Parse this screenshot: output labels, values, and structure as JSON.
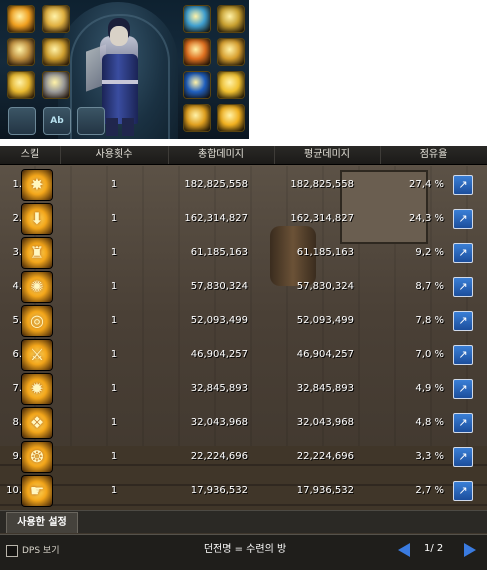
{
  "equipment": {
    "left_slots": [
      {
        "level": "",
        "stars": "",
        "icon": "fire-burst-icon",
        "color": "#f0a020"
      },
      {
        "level": "",
        "stars": "",
        "icon": "winged-orb-icon",
        "color": "#e0b040"
      },
      {
        "level": "",
        "stars": "",
        "icon": "gem-cluster-icon",
        "color": "#c09040"
      },
      {
        "level": "",
        "stars": "",
        "icon": "dark-sigil-icon",
        "color": "#d0a030"
      },
      {
        "level": "",
        "stars": "",
        "icon": "golden-crest-icon",
        "color": "#e8b830"
      },
      {
        "level": "",
        "stars": "",
        "icon": "white-helmet-icon",
        "color": "#9a9a9a"
      }
    ],
    "buttons": [
      "",
      "Ab",
      ""
    ],
    "right_slots": [
      {
        "icon": "cyan-blade-icon",
        "color": "#40a0d0"
      },
      {
        "icon": "roman-six-icon",
        "color": "#c8a030"
      },
      {
        "icon": "fire-ring-icon",
        "color": "#e07020"
      },
      {
        "icon": "green-seal-icon",
        "color": "#d8a030"
      },
      {
        "icon": "blue-ring-icon",
        "color": "#2060c0"
      },
      {
        "icon": "gold-talisman-icon",
        "color": "#f0c030"
      },
      {
        "icon": "feather-emblem-icon",
        "color": "#e0a020"
      },
      {
        "icon": "sun-medal-icon",
        "color": "#f0b020"
      }
    ]
  },
  "dps_table": {
    "headers": [
      "스킬",
      "사용횟수",
      "총합데미지",
      "평균데미지",
      "점유율"
    ],
    "rows": [
      {
        "rank": "1.",
        "icon": "explosion-skill-icon",
        "count": "1",
        "total": "182,825,558",
        "average": "182,825,558",
        "share": "27,4 %"
      },
      {
        "rank": "2.",
        "icon": "down-arrow-skill-icon",
        "count": "1",
        "total": "162,314,827",
        "average": "162,314,827",
        "share": "24,3 %"
      },
      {
        "rank": "3.",
        "icon": "lantern-skill-icon",
        "count": "1",
        "total": "61,185,163",
        "average": "61,185,163",
        "share": "9,2 %"
      },
      {
        "rank": "4.",
        "icon": "flame-orb-skill-icon",
        "count": "1",
        "total": "57,830,324",
        "average": "57,830,324",
        "share": "8,7 %"
      },
      {
        "rank": "5.",
        "icon": "spiral-skill-icon",
        "count": "1",
        "total": "52,093,499",
        "average": "52,093,499",
        "share": "7,8 %"
      },
      {
        "rank": "6.",
        "icon": "sword-slash-skill-icon",
        "count": "1",
        "total": "46,904,257",
        "average": "46,904,257",
        "share": "7,0 %"
      },
      {
        "rank": "7.",
        "icon": "gear-burst-skill-icon",
        "count": "1",
        "total": "32,845,893",
        "average": "32,845,893",
        "share": "4,9 %"
      },
      {
        "rank": "8.",
        "icon": "scroll-skill-icon",
        "count": "1",
        "total": "32,043,968",
        "average": "32,043,968",
        "share": "4,8 %"
      },
      {
        "rank": "9.",
        "icon": "dragon-skill-icon",
        "count": "1",
        "total": "22,224,696",
        "average": "22,224,696",
        "share": "3,3 %"
      },
      {
        "rank": "10.",
        "icon": "pointing-hand-skill-icon",
        "count": "1",
        "total": "17,936,532",
        "average": "17,936,532",
        "share": "2,7 %"
      }
    ]
  },
  "tabs": {
    "used_settings": "사용한 설정"
  },
  "footer": {
    "dps_toggle_label": "DPS 보기",
    "dungeon": "던전명 = 수련의 방",
    "page": "1/ 2"
  },
  "colors": {
    "share_button": "#2a66c0",
    "page_arrow": "#3a7be0"
  }
}
